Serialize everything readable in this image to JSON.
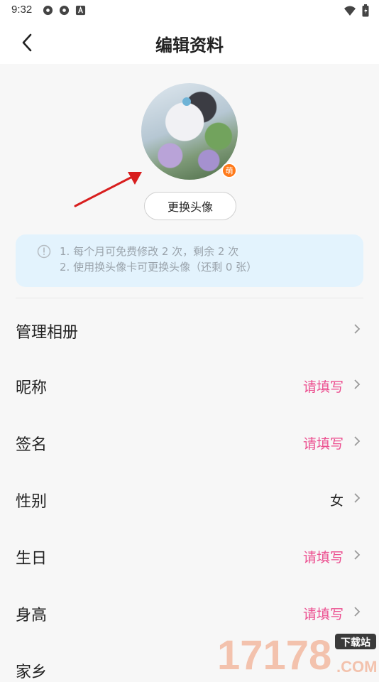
{
  "status_bar": {
    "time": "9:32",
    "icons": [
      "pinwheel-icon",
      "pinwheel-icon",
      "font-icon",
      "wifi-icon",
      "battery-icon"
    ]
  },
  "header": {
    "title": "编辑资料"
  },
  "avatar": {
    "badge": "萌",
    "change_button_label": "更换头像"
  },
  "notice": {
    "line1": "1. 每个月可免费修改 2 次，剩余 2 次",
    "line2": "2. 使用换头像卡可更换头像（还剩 0 张）"
  },
  "rows": [
    {
      "label": "管理相册",
      "value": ""
    },
    {
      "label": "昵称",
      "value": "请填写"
    },
    {
      "label": "签名",
      "value": "请填写"
    },
    {
      "label": "性别",
      "value": "女"
    },
    {
      "label": "生日",
      "value": "请填写"
    },
    {
      "label": "身高",
      "value": "请填写"
    },
    {
      "label": "家乡",
      "value": ""
    }
  ],
  "watermark": {
    "text": "17178",
    "sub": "下载站",
    "suffix": ".COM"
  },
  "colors": {
    "accent": "#ec4e8f",
    "notice_bg": "#e3f3fd",
    "badge": "#ff7a1a",
    "annotation_arrow": "#d81e1e"
  }
}
